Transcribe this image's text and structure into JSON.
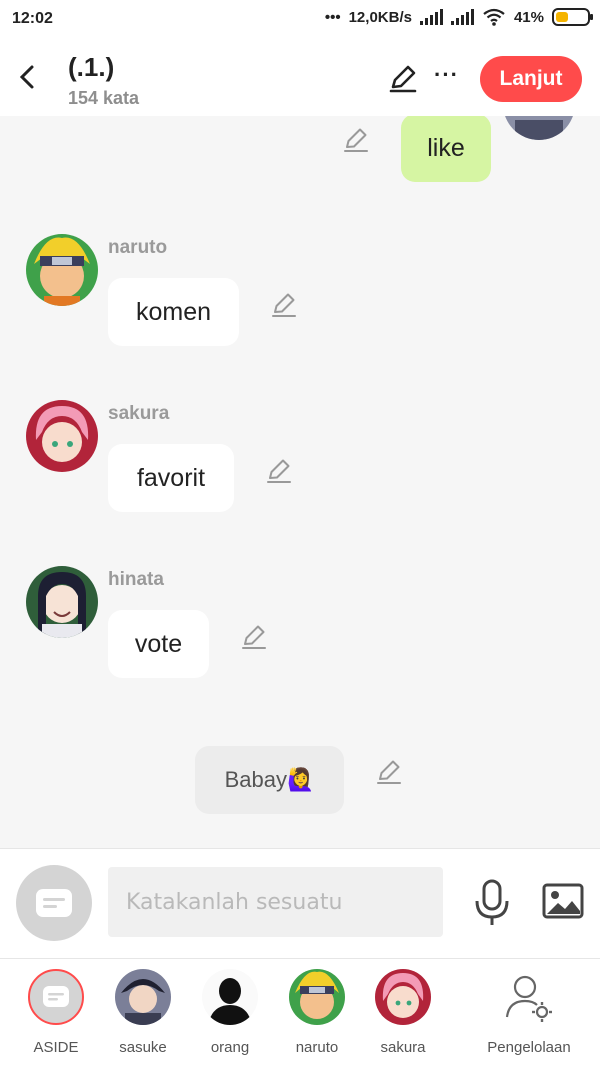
{
  "status_bar": {
    "time": "12:02",
    "network_speed": "12,0KB/s",
    "battery": "41%",
    "battery_level": 0.41
  },
  "header": {
    "title": "(.1.)",
    "subtitle": "154 kata",
    "next_label": "Lanjut",
    "accent_color": "#ff4b4b"
  },
  "messages": [
    {
      "type": "right",
      "text": "like",
      "bubble_color": "#d6f5a3"
    },
    {
      "type": "left",
      "name": "naruto",
      "text": "komen"
    },
    {
      "type": "left",
      "name": "sakura",
      "text": "favorit"
    },
    {
      "type": "left",
      "name": "hinata",
      "text": "vote"
    },
    {
      "type": "narration",
      "text": "Babay🙋‍♀️"
    }
  ],
  "input": {
    "placeholder": "Katakanlah sesuatu"
  },
  "characters": [
    {
      "label": "ASIDE"
    },
    {
      "label": "sasuke"
    },
    {
      "label": "orang"
    },
    {
      "label": "naruto"
    },
    {
      "label": "sakura"
    }
  ],
  "manage_label": "Pengelolaan"
}
